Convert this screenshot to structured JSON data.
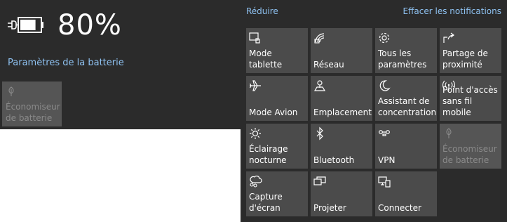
{
  "battery": {
    "percent": "80%",
    "charge_level": 0.8,
    "settings_link": "Paramètres de la batterie",
    "saver_tile": {
      "label": "Économiseur de batterie",
      "icon": "leaf-icon",
      "enabled": false
    }
  },
  "action_center": {
    "collapse_link": "Réduire",
    "clear_link": "Effacer les notifications",
    "tiles": [
      {
        "label": "Mode tablette",
        "icon": "tablet-mode-icon",
        "enabled": true
      },
      {
        "label": "Réseau",
        "icon": "network-icon",
        "enabled": true
      },
      {
        "label": "Tous les paramètres",
        "icon": "gear-icon",
        "enabled": true
      },
      {
        "label": "Partage de proximité",
        "icon": "share-icon",
        "enabled": true
      },
      {
        "label": "Mode Avion",
        "icon": "airplane-icon",
        "enabled": true
      },
      {
        "label": "Emplacement",
        "icon": "location-icon",
        "enabled": true
      },
      {
        "label": "Assistant de concentration",
        "icon": "moon-icon",
        "enabled": true
      },
      {
        "label": "Point d'accès sans fil mobile",
        "icon": "hotspot-icon",
        "enabled": true
      },
      {
        "label": "Éclairage nocturne",
        "icon": "sun-icon",
        "enabled": true
      },
      {
        "label": "Bluetooth",
        "icon": "bluetooth-icon",
        "enabled": true
      },
      {
        "label": "VPN",
        "icon": "vpn-icon",
        "enabled": true
      },
      {
        "label": "Économiseur de batterie",
        "icon": "leaf-icon",
        "enabled": false
      },
      {
        "label": "Capture d'écran",
        "icon": "snip-icon",
        "enabled": true
      },
      {
        "label": "Projeter",
        "icon": "project-icon",
        "enabled": true
      },
      {
        "label": "Connecter",
        "icon": "connect-icon",
        "enabled": true
      }
    ]
  }
}
